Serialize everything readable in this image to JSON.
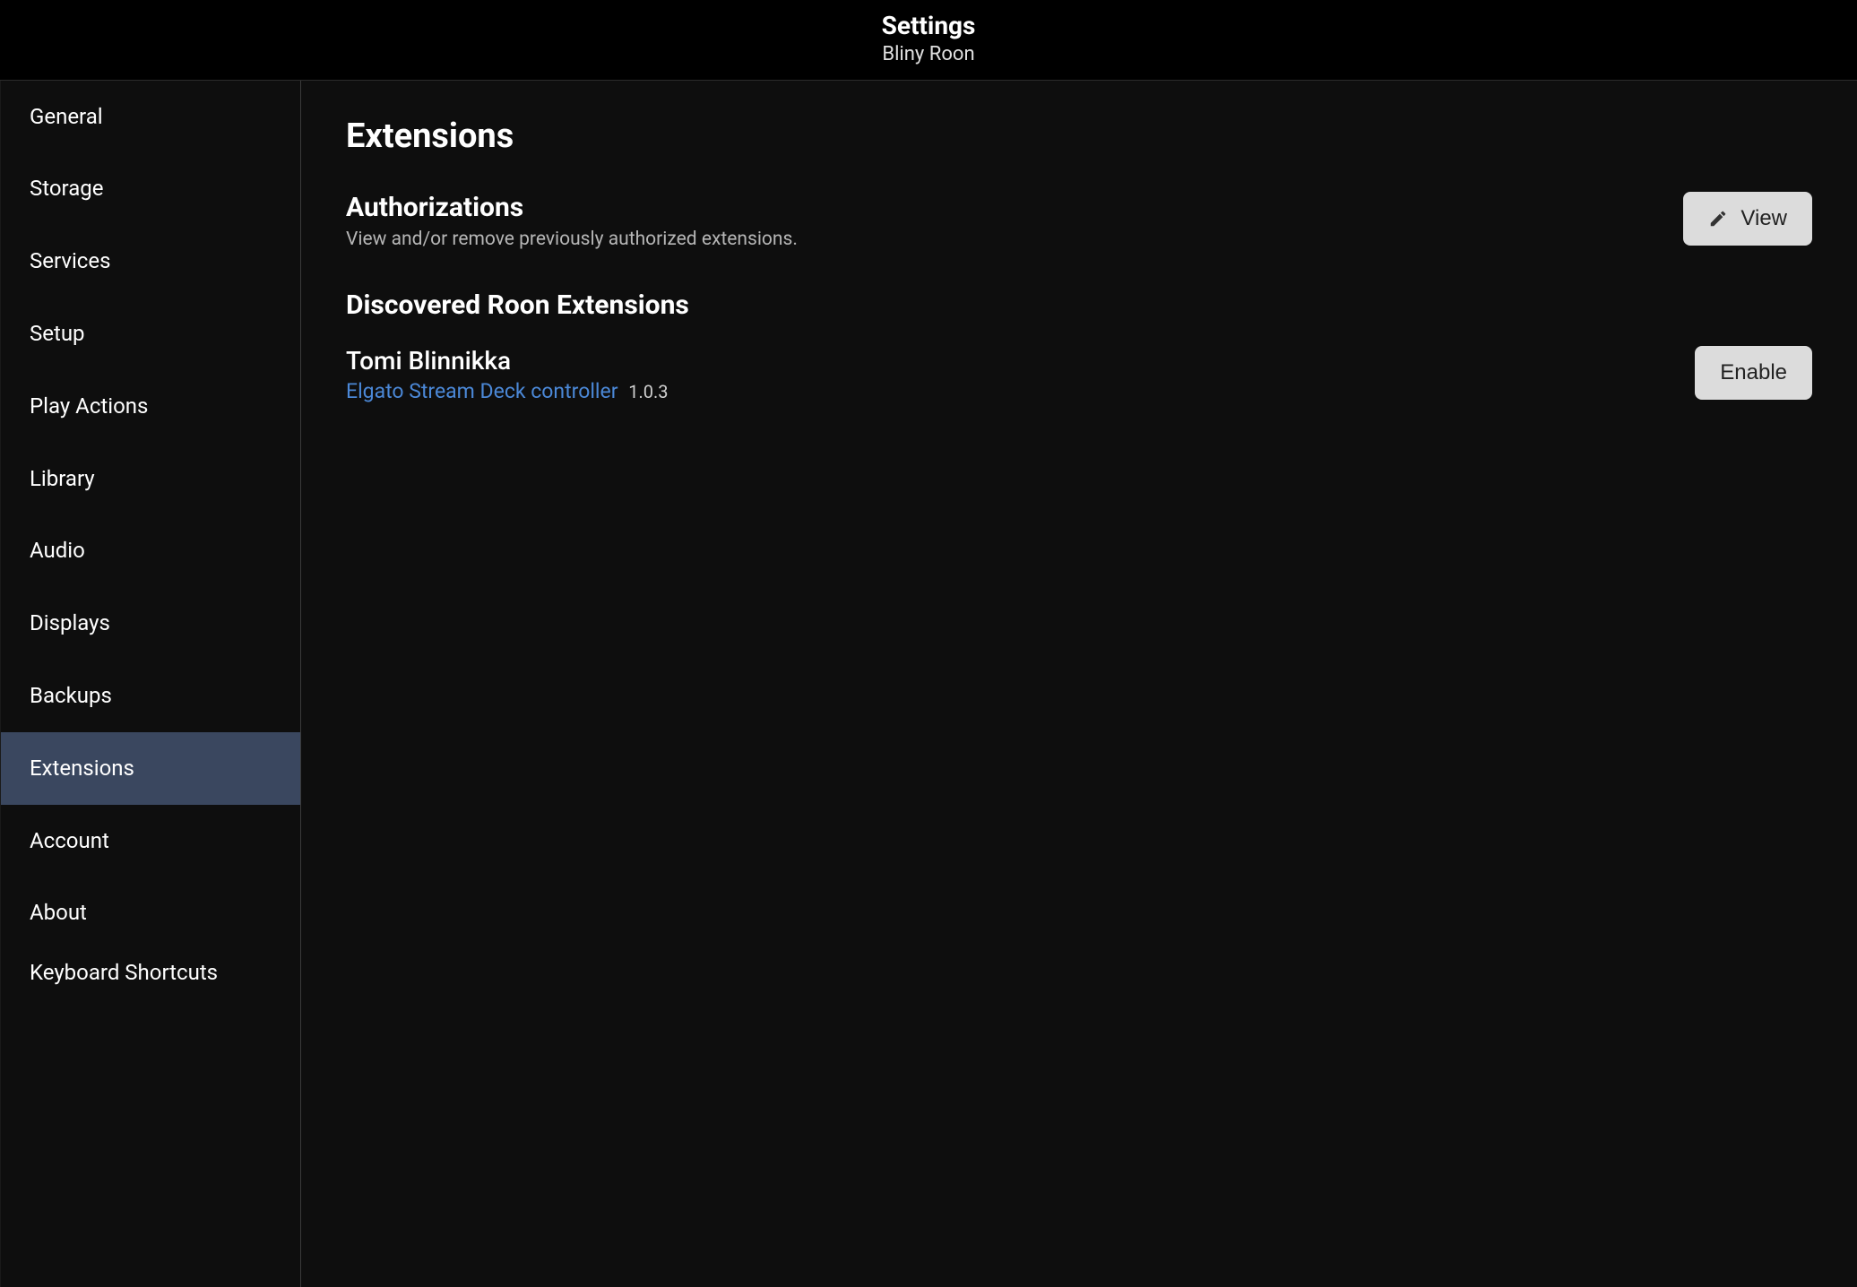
{
  "header": {
    "title": "Settings",
    "subtitle": "Bliny Roon"
  },
  "sidebar": {
    "items": [
      {
        "label": "General"
      },
      {
        "label": "Storage"
      },
      {
        "label": "Services"
      },
      {
        "label": "Setup"
      },
      {
        "label": "Play Actions"
      },
      {
        "label": "Library"
      },
      {
        "label": "Audio"
      },
      {
        "label": "Displays"
      },
      {
        "label": "Backups"
      },
      {
        "label": "Extensions",
        "active": true
      },
      {
        "label": "Account"
      },
      {
        "label": "About"
      },
      {
        "label": "Keyboard Shortcuts"
      }
    ]
  },
  "main": {
    "page_title": "Extensions",
    "authorizations": {
      "title": "Authorizations",
      "desc": "View and/or remove previously authorized extensions.",
      "view_button": "View"
    },
    "discovered": {
      "title": "Discovered Roon Extensions",
      "extensions": [
        {
          "author": "Tomi Blinnikka",
          "name": "Elgato Stream Deck controller",
          "version": "1.0.3",
          "action_label": "Enable"
        }
      ]
    }
  }
}
